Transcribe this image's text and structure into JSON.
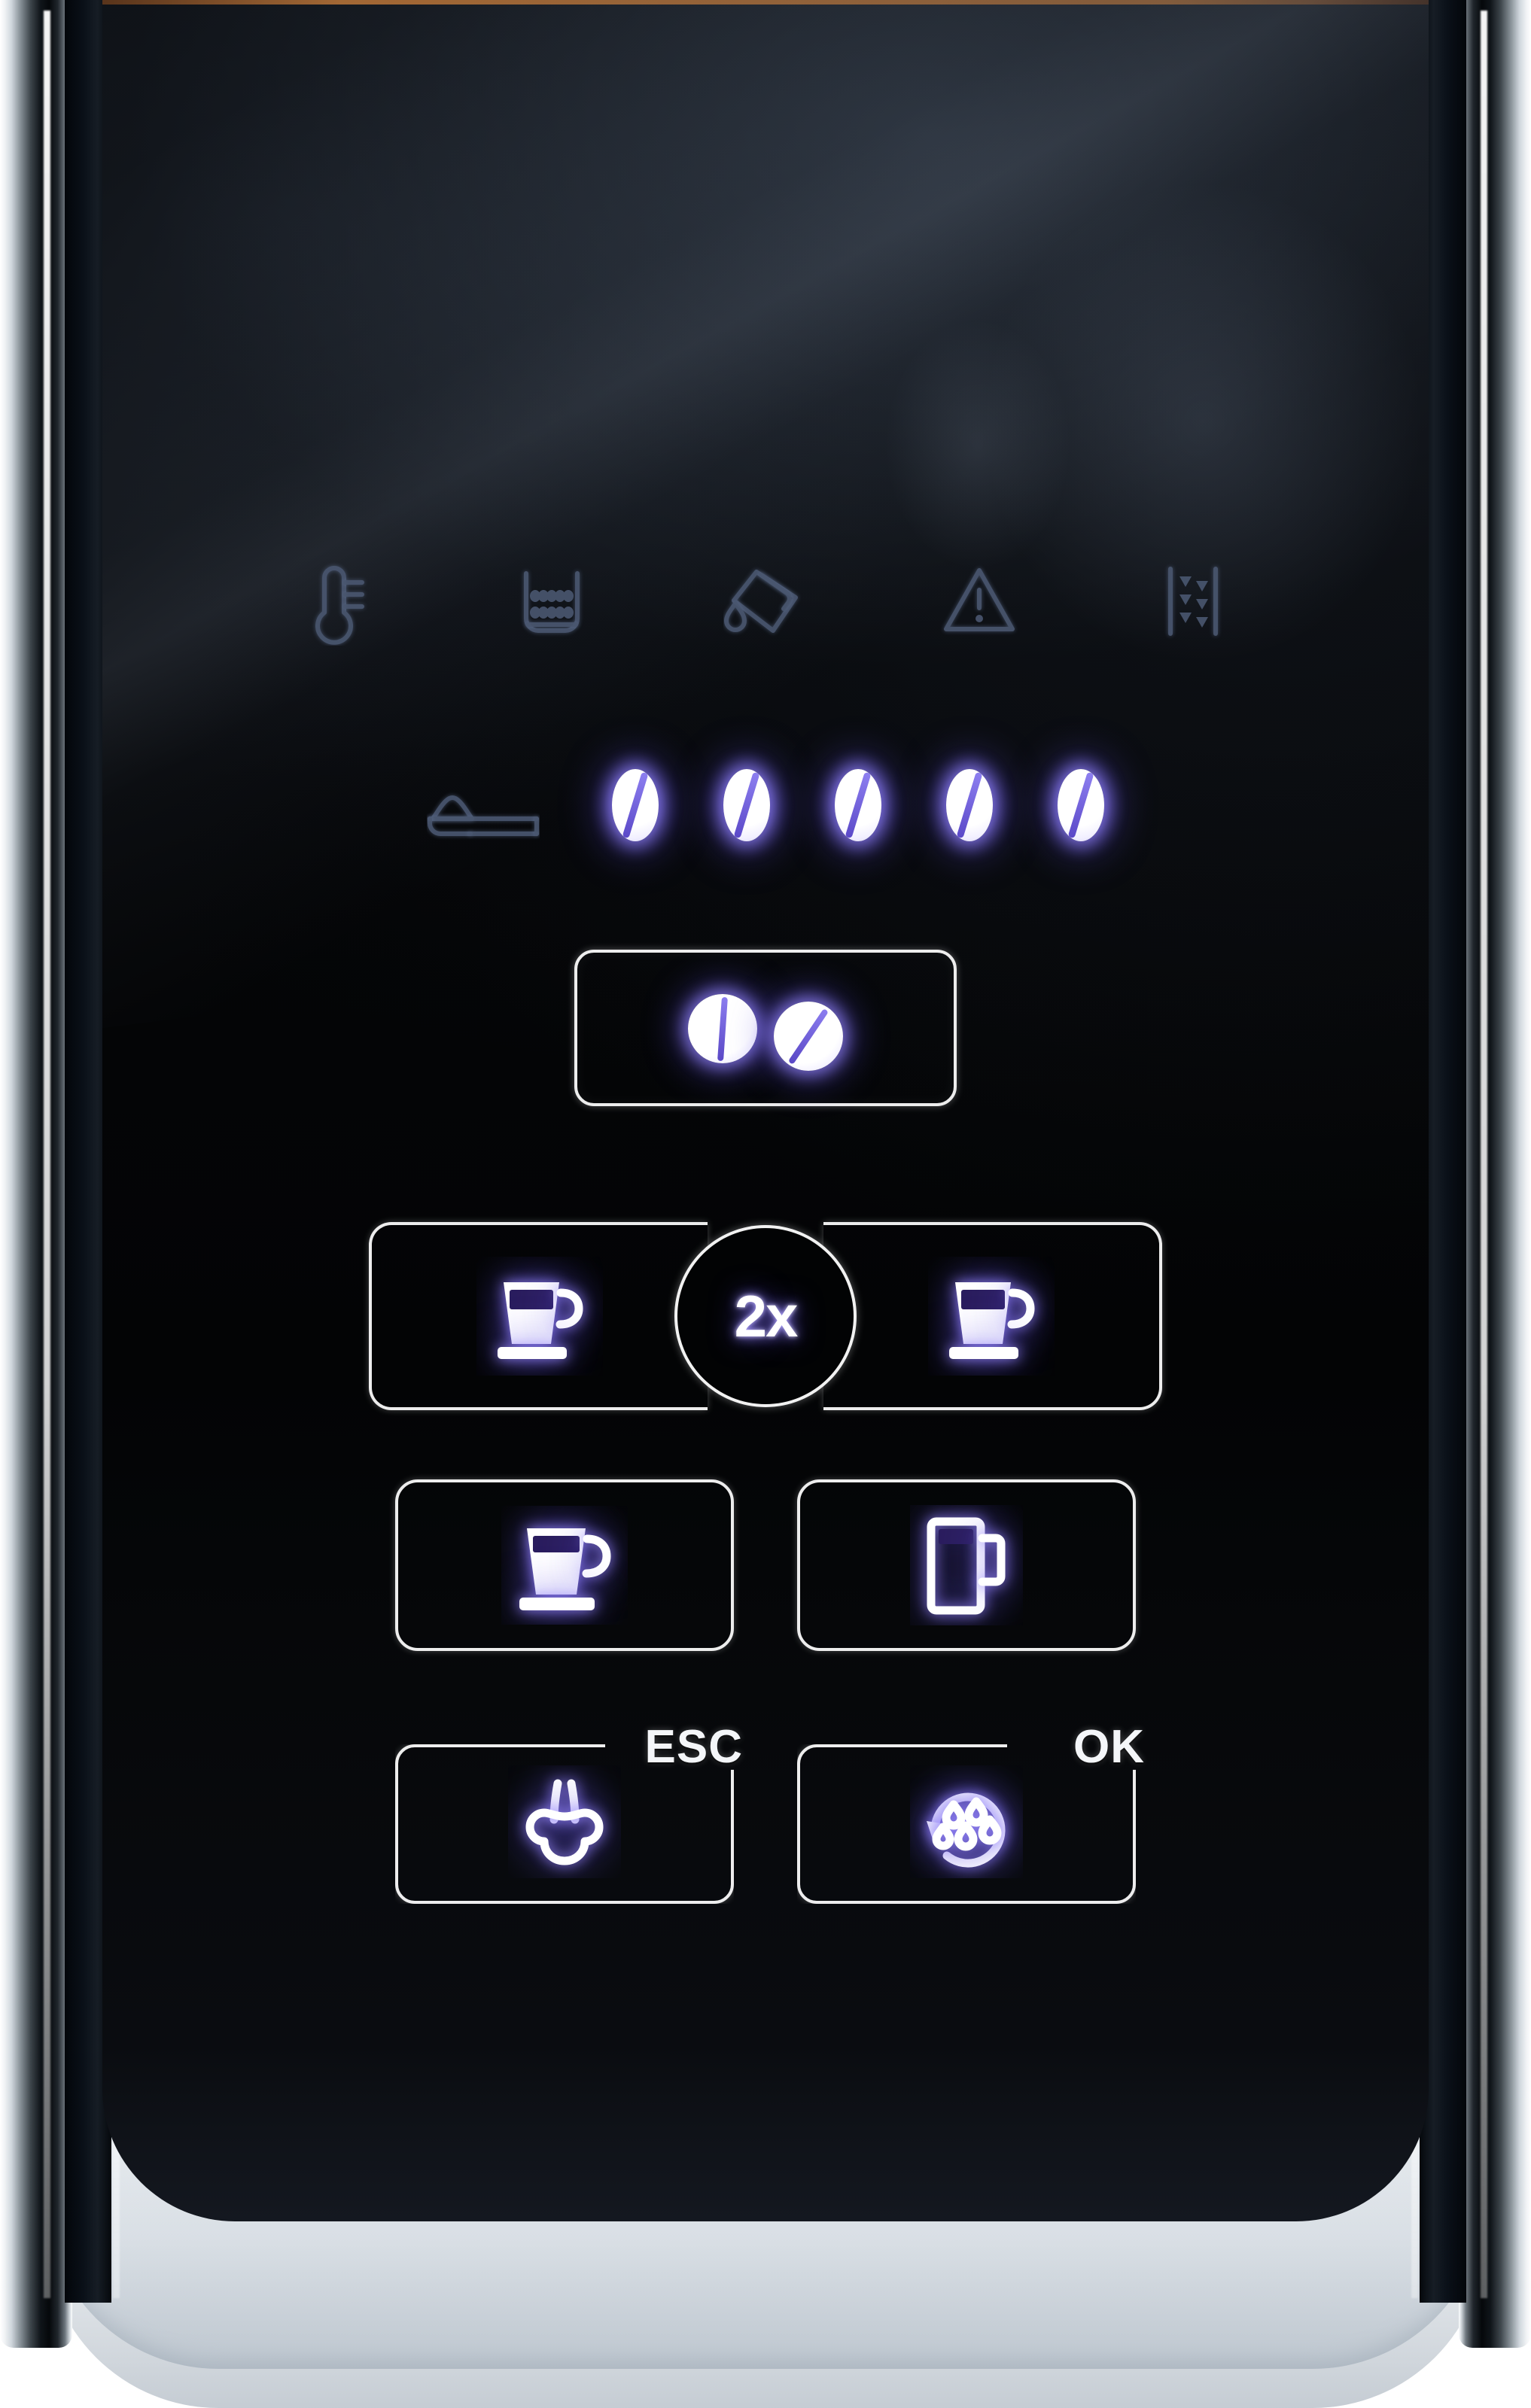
{
  "device": {
    "name": "espresso-machine-control-panel",
    "surface": "glossy black touch glass",
    "bezel_color": "#f4f6f8",
    "glass_color": "#050608"
  },
  "colors": {
    "lamp_white": "#ffffff",
    "lamp_glow_violet": "#9888ff",
    "lamp_glow_deep": "#604ee2",
    "engraved_icon": "#4a5770",
    "outline_white": "#ffffff",
    "label_text": "#f4f6f9"
  },
  "status_indicators": {
    "label": "status indicator row",
    "lit": false,
    "items": [
      {
        "icon": "thermometer-icon",
        "name": "temperature-indicator",
        "meaning": "Temperature / heating"
      },
      {
        "icon": "grounds-container-icon",
        "name": "grounds-container-indicator",
        "meaning": "Empty coffee grounds container"
      },
      {
        "icon": "water-tank-drip-icon",
        "name": "water-tank-indicator",
        "meaning": "Fill water tank / drip tray"
      },
      {
        "icon": "warning-triangle-icon",
        "name": "general-warning-indicator",
        "meaning": "General fault warning"
      },
      {
        "icon": "grinder-burr-icon",
        "name": "grinder-indicator",
        "meaning": "Grinder / descale"
      }
    ]
  },
  "strength_row": {
    "ground_coffee_icon": "coffee-scoop-icon",
    "ground_coffee_name": "pre-ground-coffee-indicator",
    "bean_lamps_total": 5,
    "bean_lamps_lit": 5,
    "lit": true
  },
  "aroma_button": {
    "name": "aroma-strength-button",
    "icon": "two-coffee-beans-icon",
    "lit": true,
    "border": "rounded-rectangle"
  },
  "espresso_row": [
    {
      "name": "espresso-single-left-button",
      "icon": "espresso-cup-icon",
      "lit": true
    },
    {
      "name": "double-shot-button",
      "label": "2x",
      "icon": "text-label",
      "lit": true
    },
    {
      "name": "espresso-single-right-button",
      "icon": "espresso-cup-icon",
      "lit": true
    }
  ],
  "coffee_row": [
    {
      "name": "coffee-cup-button",
      "icon": "coffee-cup-saucer-icon",
      "lit": true
    },
    {
      "name": "tall-mug-button",
      "icon": "tall-mug-icon",
      "lit": true
    }
  ],
  "function_row": [
    {
      "name": "steam-esc-button",
      "label": "ESC",
      "icon": "steam-nozzle-icon",
      "lit": true
    },
    {
      "name": "rinse-ok-button",
      "label": "OK",
      "icon": "rinse-cycle-icon",
      "lit": true
    }
  ]
}
